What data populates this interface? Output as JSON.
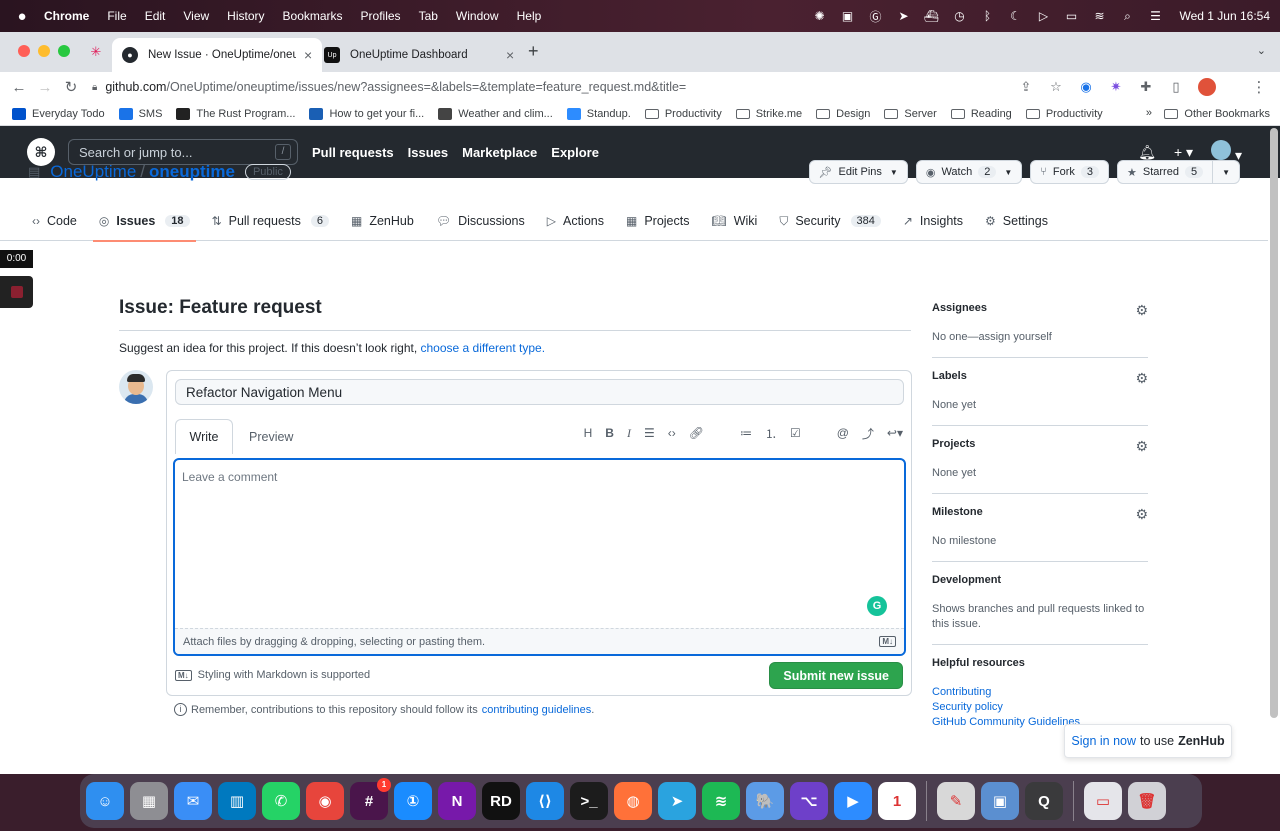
{
  "menubar": {
    "apple": "",
    "items": [
      "Chrome",
      "File",
      "Edit",
      "View",
      "History",
      "Bookmarks",
      "Profiles",
      "Tab",
      "Window",
      "Help"
    ],
    "clock": "Wed 1 Jun  16:54"
  },
  "browser": {
    "tabs": [
      {
        "title": "New Issue · OneUptime/oneupti",
        "favicon": "github-icon"
      },
      {
        "title": "OneUptime Dashboard",
        "favicon": "oneuptime-icon",
        "favicon_text": "Up"
      }
    ],
    "url_host": "github.com",
    "url_path": "/OneUptime/oneuptime/issues/new?assignees=&labels=&template=feature_request.md&title=",
    "bookmarks": [
      {
        "label": "Everyday Todo",
        "icon": "trello-icon",
        "color": "#0052cc"
      },
      {
        "label": "SMS",
        "icon": "sms-icon",
        "color": "#1a73e8"
      },
      {
        "label": "The Rust Program...",
        "icon": "rust-icon",
        "color": "#222222"
      },
      {
        "label": "How to get your fi...",
        "icon": "d-icon",
        "color": "#1a5fb4"
      },
      {
        "label": "Weather and clim...",
        "icon": "weather-icon",
        "color": "#444444"
      },
      {
        "label": "Standup.",
        "icon": "zoom-icon",
        "color": "#2d8cff"
      },
      {
        "label": "Productivity",
        "icon": "folder-icon"
      },
      {
        "label": "Strike.me",
        "icon": "folder-icon"
      },
      {
        "label": "Design",
        "icon": "folder-icon"
      },
      {
        "label": "Server",
        "icon": "folder-icon"
      },
      {
        "label": "Reading",
        "icon": "folder-icon"
      },
      {
        "label": "Productivity",
        "icon": "folder-icon"
      }
    ],
    "more": "»",
    "other_bookmarks": "Other Bookmarks"
  },
  "github": {
    "search_placeholder": "Search or jump to...",
    "search_key": "/",
    "nav": [
      "Pull requests",
      "Issues",
      "Marketplace",
      "Explore"
    ],
    "owner": "OneUptime",
    "separator": "/",
    "repo": "oneuptime",
    "visibility": "Public",
    "actions": {
      "edit_pins": "Edit Pins",
      "watch": "Watch",
      "watch_count": "2",
      "fork": "Fork",
      "fork_count": "3",
      "starred": "Starred",
      "star_count": "5"
    },
    "tabs": [
      {
        "label": "Code",
        "icon": "code-icon",
        "count": ""
      },
      {
        "label": "Issues",
        "icon": "issue-icon",
        "count": "18"
      },
      {
        "label": "Pull requests",
        "icon": "pull-request-icon",
        "count": "6"
      },
      {
        "label": "ZenHub",
        "icon": "zenhub-icon",
        "count": ""
      },
      {
        "label": "Discussions",
        "icon": "discussion-icon",
        "count": ""
      },
      {
        "label": "Actions",
        "icon": "play-icon",
        "count": ""
      },
      {
        "label": "Projects",
        "icon": "table-icon",
        "count": ""
      },
      {
        "label": "Wiki",
        "icon": "book-icon",
        "count": ""
      },
      {
        "label": "Security",
        "icon": "shield-icon",
        "count": "384"
      },
      {
        "label": "Insights",
        "icon": "graph-icon",
        "count": ""
      },
      {
        "label": "Settings",
        "icon": "gear-icon",
        "count": ""
      }
    ]
  },
  "recorder": {
    "timer": "0:00"
  },
  "issue": {
    "heading": "Issue: Feature request",
    "suggest_text": "Suggest an idea for this project. If this doesn’t look right, ",
    "suggest_link": "choose a different type.",
    "title_value": "Refactor Navigation Menu",
    "write_tab": "Write",
    "preview_tab": "Preview",
    "comment_placeholder": "Leave a comment",
    "attach_text": "Attach files by dragging & dropping, selecting or pasting them.",
    "md_badge": "M↓",
    "markdown_note": "Styling with Markdown is supported",
    "submit": "Submit new issue",
    "remember_text": "Remember, contributions to this repository should follow its",
    "remember_link": "contributing guidelines",
    "remember_end": "."
  },
  "sidebar": {
    "assignees_heading": "Assignees",
    "assignees_value": "No one—assign yourself",
    "labels_heading": "Labels",
    "labels_value": "None yet",
    "projects_heading": "Projects",
    "projects_value": "None yet",
    "milestone_heading": "Milestone",
    "milestone_value": "No milestone",
    "development_heading": "Development",
    "development_value": "Shows branches and pull requests linked to this issue.",
    "resources_heading": "Helpful resources",
    "resources_links": [
      "Contributing",
      "Security policy",
      "GitHub Community Guidelines"
    ]
  },
  "zenhub_popup": {
    "link": "Sign in now",
    "text": "to use",
    "brand": "ZenHub"
  },
  "dock": {
    "apps": [
      {
        "name": "finder",
        "color": "#2f8ff0",
        "glyph": "☺"
      },
      {
        "name": "launchpad",
        "color": "#8e8e93",
        "glyph": "▦"
      },
      {
        "name": "mail",
        "color": "#3a8ef6",
        "glyph": "✉"
      },
      {
        "name": "trello",
        "color": "#0079bf",
        "glyph": "▥"
      },
      {
        "name": "whatsapp",
        "color": "#25d366",
        "glyph": "✆"
      },
      {
        "name": "chrome",
        "color": "#e7453c",
        "glyph": "◉"
      },
      {
        "name": "slack",
        "color": "#4a154b",
        "glyph": "#",
        "badge": "1"
      },
      {
        "name": "1password",
        "color": "#1a8cff",
        "glyph": "①"
      },
      {
        "name": "onenote",
        "color": "#7719aa",
        "glyph": "N"
      },
      {
        "name": "rider",
        "color": "#111111",
        "glyph": "RD"
      },
      {
        "name": "vscode",
        "color": "#1e88e5",
        "glyph": "⟨⟩"
      },
      {
        "name": "terminal",
        "color": "#1c1c1c",
        "glyph": ">_"
      },
      {
        "name": "firefox",
        "color": "#ff7139",
        "glyph": "◍"
      },
      {
        "name": "telegram",
        "color": "#2aa3df",
        "glyph": "➤"
      },
      {
        "name": "spotify",
        "color": "#1db954",
        "glyph": "≋"
      },
      {
        "name": "tableplus",
        "color": "#5c9be6",
        "glyph": "🐘"
      },
      {
        "name": "github-desktop",
        "color": "#6e40c9",
        "glyph": "⌥"
      },
      {
        "name": "zoom",
        "color": "#2d8cff",
        "glyph": "▶"
      },
      {
        "name": "calendar",
        "color": "#ffffff",
        "glyph": "1"
      },
      {
        "name": "textedit",
        "color": "#d8d8d8",
        "glyph": "✎"
      },
      {
        "name": "preview",
        "color": "#5b8fd0",
        "glyph": "▣"
      },
      {
        "name": "quicktime",
        "color": "#3a3a3c",
        "glyph": "Q"
      },
      {
        "name": "downloads",
        "color": "#e5e5ea",
        "glyph": "▭"
      },
      {
        "name": "trash",
        "color": "#d1d1d6",
        "glyph": "🗑"
      }
    ]
  }
}
